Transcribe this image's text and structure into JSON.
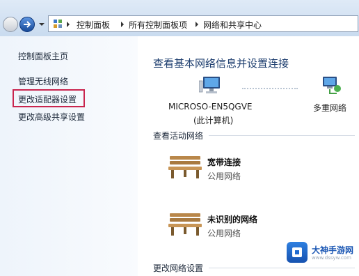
{
  "address_bar": {
    "crumbs": [
      "控制面板",
      "所有控制面板项",
      "网络和共享中心"
    ]
  },
  "nav": {
    "items": [
      {
        "label": "控制面板主页"
      },
      {
        "label": "管理无线网络"
      },
      {
        "label": "更改适配器设置"
      },
      {
        "label": "更改高级共享设置"
      }
    ],
    "highlight_color": "#c9254e"
  },
  "main": {
    "title": "查看基本网络信息并设置连接",
    "map": {
      "computer_name": "MICROSO-EN5QGVE",
      "computer_sub": "(此计算机)",
      "network_label": "多重网络"
    },
    "active_section": "查看活动网络",
    "networks": [
      {
        "name": "宽带连接",
        "type": "公用网络"
      },
      {
        "name": "未识别的网络",
        "type": "公用网络"
      }
    ],
    "change_section": "更改网络设置"
  },
  "watermark": {
    "name": "大神手游网",
    "site": "www.dssyw.com"
  }
}
